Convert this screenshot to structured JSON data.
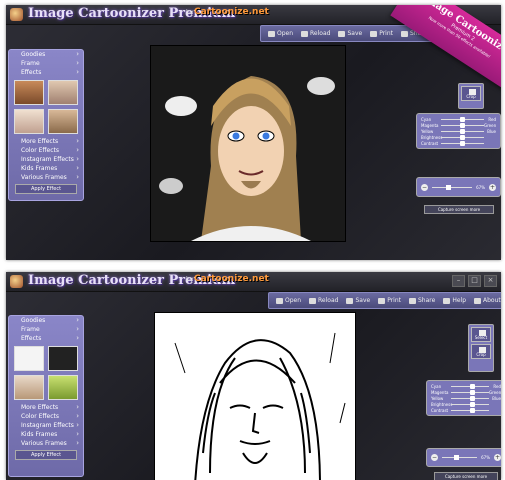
{
  "app": {
    "title": "Image Cartoonizer Premium",
    "by": "by",
    "brand": "Cartoonize.net"
  },
  "window_buttons": [
    "–",
    "□",
    "×"
  ],
  "toolbar_top": [
    "Open",
    "Reload",
    "Save",
    "Print",
    "Share"
  ],
  "toolbar_bottom": [
    "Open",
    "Reload",
    "Save",
    "Print",
    "Share",
    "Help",
    "About"
  ],
  "ribbon": {
    "line1": "Image Cartoonizer",
    "line2": "Premium 2",
    "line3": "Now more than 50 effects available!"
  },
  "left_menu": {
    "top_items": [
      "Goodies",
      "Frame",
      "Effects"
    ],
    "bottom_items": [
      "More Effects",
      "Color Effects",
      "Instagram Effects",
      "Kids Frames",
      "Various Frames"
    ],
    "apply_label": "Apply Effect"
  },
  "right_side": {
    "top_buttons": [
      "Crop"
    ],
    "bottom_buttons": [
      "Select",
      "Crop"
    ]
  },
  "adjust": {
    "rows": [
      {
        "left": "Cyan",
        "right": "Red"
      },
      {
        "left": "Magenta",
        "right": "Green"
      },
      {
        "left": "Yellow",
        "right": "Blue"
      },
      {
        "left": "Brightness",
        "right": ""
      },
      {
        "left": "Contrast",
        "right": ""
      }
    ]
  },
  "zoom": {
    "top_value": "67%",
    "bottom_value": "67%",
    "minus": "−",
    "plus": "+"
  },
  "capture_label": "Capture screen more",
  "colors": {
    "panel": "#7a76b8",
    "ribbon": "#d62a9a",
    "brand": "#ff9a3c"
  }
}
